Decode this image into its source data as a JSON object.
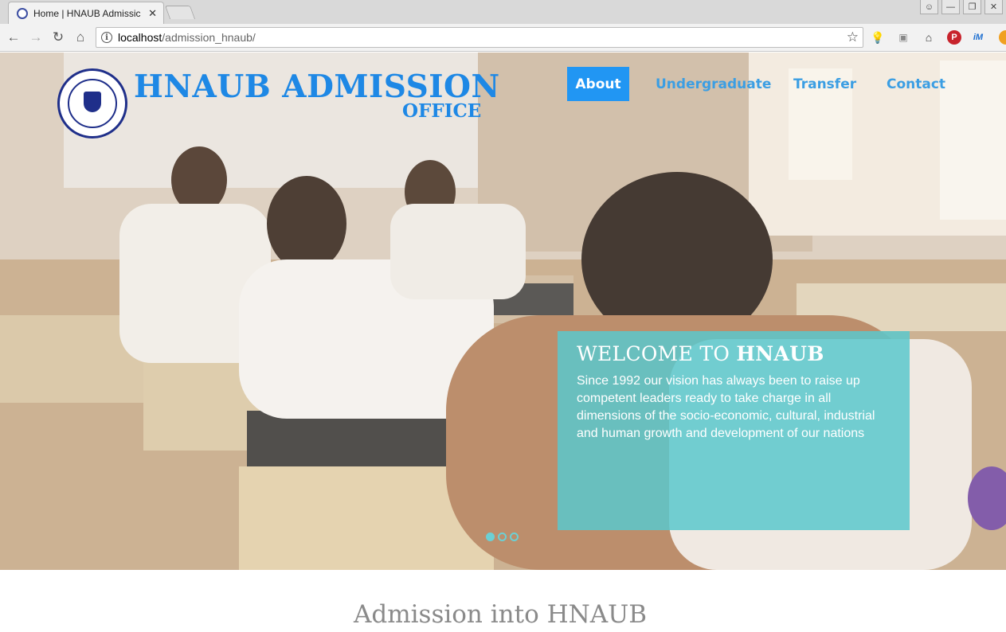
{
  "browser": {
    "tab_title": "Home | HNAUB Admissic",
    "url_host": "localhost",
    "url_path": "/admission_hnaub/"
  },
  "header": {
    "brand_main": "HNAUB ADMISSION",
    "brand_sub": "OFFICE",
    "nav": [
      "About",
      "Undergraduate",
      "Transfer",
      "Contact"
    ],
    "active_nav": "About"
  },
  "hero": {
    "welcome_prefix": "WELCOME TO ",
    "welcome_name": "HNAUB",
    "welcome_text": "Since 1992 our vision has always been to raise up competent leaders ready to take charge in all dimensions of the socio-economic, cultural, industrial and human growth and development of our nations",
    "slides": 3,
    "active_slide": 1
  },
  "content": {
    "section_title": "Admission into HNAUB"
  },
  "colors": {
    "brand_blue": "#1e88e5",
    "nav_active_bg": "#2196f3",
    "welcome_panel": "#5ac8cd",
    "heading_gray": "#8a8a8a"
  }
}
